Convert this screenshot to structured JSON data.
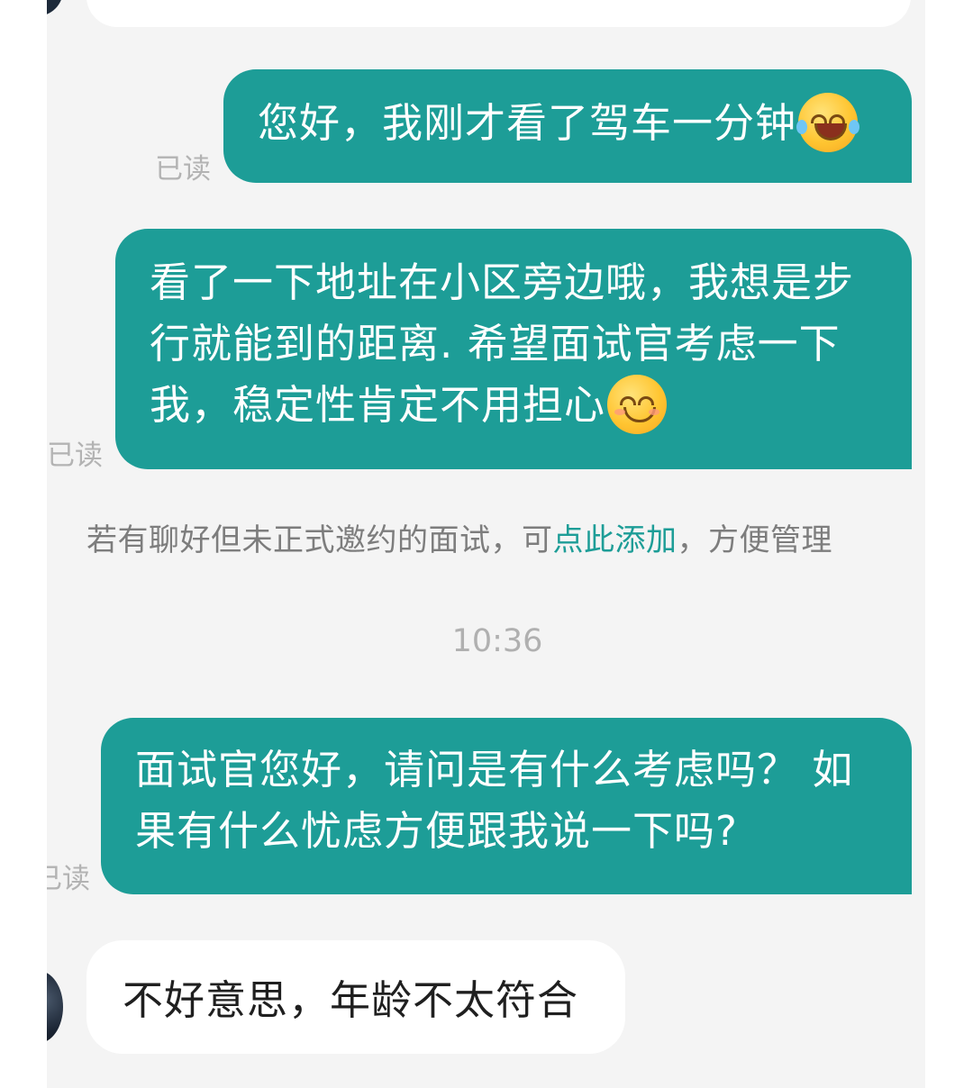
{
  "messages": {
    "m1": {
      "text": "您好，我刚才看了驾车一分钟",
      "emoji": "laughing-tears-emoji",
      "status": "已读"
    },
    "m2": {
      "line1": "看了一下地址在小区旁边哦，我想是步",
      "line2": "行就能到的距离. 希望面试官考虑一下",
      "line3": "我，稳定性肯定不用担心",
      "emoji": "smiling-blush-emoji",
      "status": "已读"
    },
    "m3": {
      "line1": "面试官您好，请问是有什么考虑吗？ 如",
      "line2": "果有什么忧虑方便跟我说一下吗?",
      "status": "已读"
    },
    "reply": {
      "text": "不好意思，年龄不太符合"
    }
  },
  "notice": {
    "prefix": "若有聊好但未正式邀约的面试，可",
    "link": "点此添加",
    "suffix": "，方便管理"
  },
  "timestamp": "10:36",
  "colors": {
    "outgoing_bubble": "#1d9d97",
    "background": "#f4f4f4",
    "link": "#1d9d97",
    "read_status": "#b3b3b3"
  }
}
